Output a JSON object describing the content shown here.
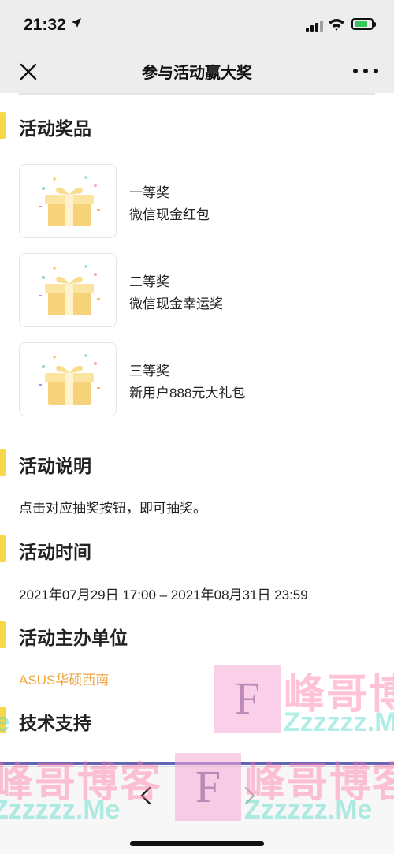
{
  "status_bar": {
    "time": "21:32",
    "location_icon": "location-arrow-icon"
  },
  "nav": {
    "title": "参与活动赢大奖",
    "close_icon": "close-icon",
    "more_icon": "more-dots-icon"
  },
  "prizes_section": {
    "title": "活动奖品",
    "items": [
      {
        "rank": "一等奖",
        "name": "微信现金红包",
        "icon": "gift-box-icon"
      },
      {
        "rank": "二等奖",
        "name": "微信现金幸运奖",
        "icon": "gift-box-icon"
      },
      {
        "rank": "三等奖",
        "name": "新用户888元大礼包",
        "icon": "gift-box-icon"
      }
    ]
  },
  "description_section": {
    "title": "活动说明",
    "text": "点击对应抽奖按钮，即可抽奖。"
  },
  "time_section": {
    "title": "活动时间",
    "text": "2021年07月29日 17:00 – 2021年08月31日 23:59"
  },
  "organizer_section": {
    "title": "活动主办单位",
    "text": "ASUS华硕西南"
  },
  "support_section": {
    "title": "技术支持"
  },
  "watermark": {
    "cn": "峰哥博客",
    "en": "Zzzzzz.Me",
    "logo": "F"
  },
  "toolbar": {
    "back_icon": "chevron-left-icon",
    "forward_icon": "chevron-right-icon"
  },
  "colors": {
    "accent_bar": "#f7d84b",
    "organizer_text": "#f0a640",
    "battery": "#35c759"
  }
}
